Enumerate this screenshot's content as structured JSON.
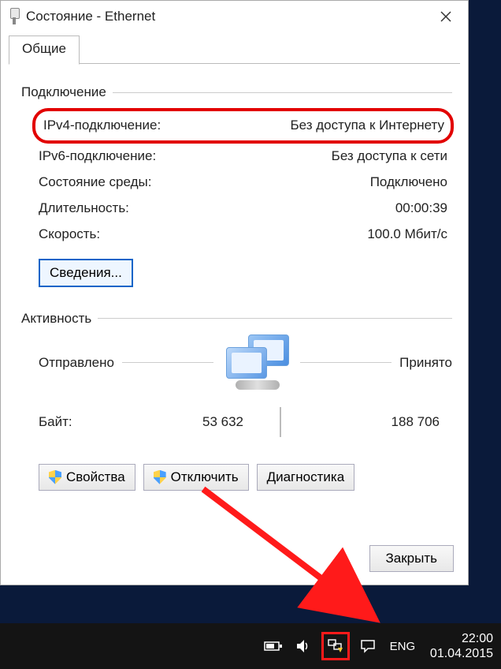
{
  "window": {
    "title": "Состояние - Ethernet",
    "tab_label": "Общие"
  },
  "connection": {
    "group_label": "Подключение",
    "rows": [
      {
        "label": "IPv4-подключение:",
        "value": "Без доступа к Интернету"
      },
      {
        "label": "IPv6-подключение:",
        "value": "Без доступа к сети"
      },
      {
        "label": "Состояние среды:",
        "value": "Подключено"
      },
      {
        "label": "Длительность:",
        "value": "00:00:39"
      },
      {
        "label": "Скорость:",
        "value": "100.0 Мбит/с"
      }
    ],
    "details_button": "Сведения..."
  },
  "activity": {
    "group_label": "Активность",
    "sent_label": "Отправлено",
    "recv_label": "Принято",
    "bytes_label": "Байт:",
    "sent_value": "53 632",
    "recv_value": "188 706"
  },
  "buttons": {
    "properties": "Свойства",
    "disable": "Отключить",
    "diagnose": "Диагностика",
    "close": "Закрыть"
  },
  "taskbar": {
    "lang": "ENG",
    "time": "22:00",
    "date": "01.04.2015"
  }
}
